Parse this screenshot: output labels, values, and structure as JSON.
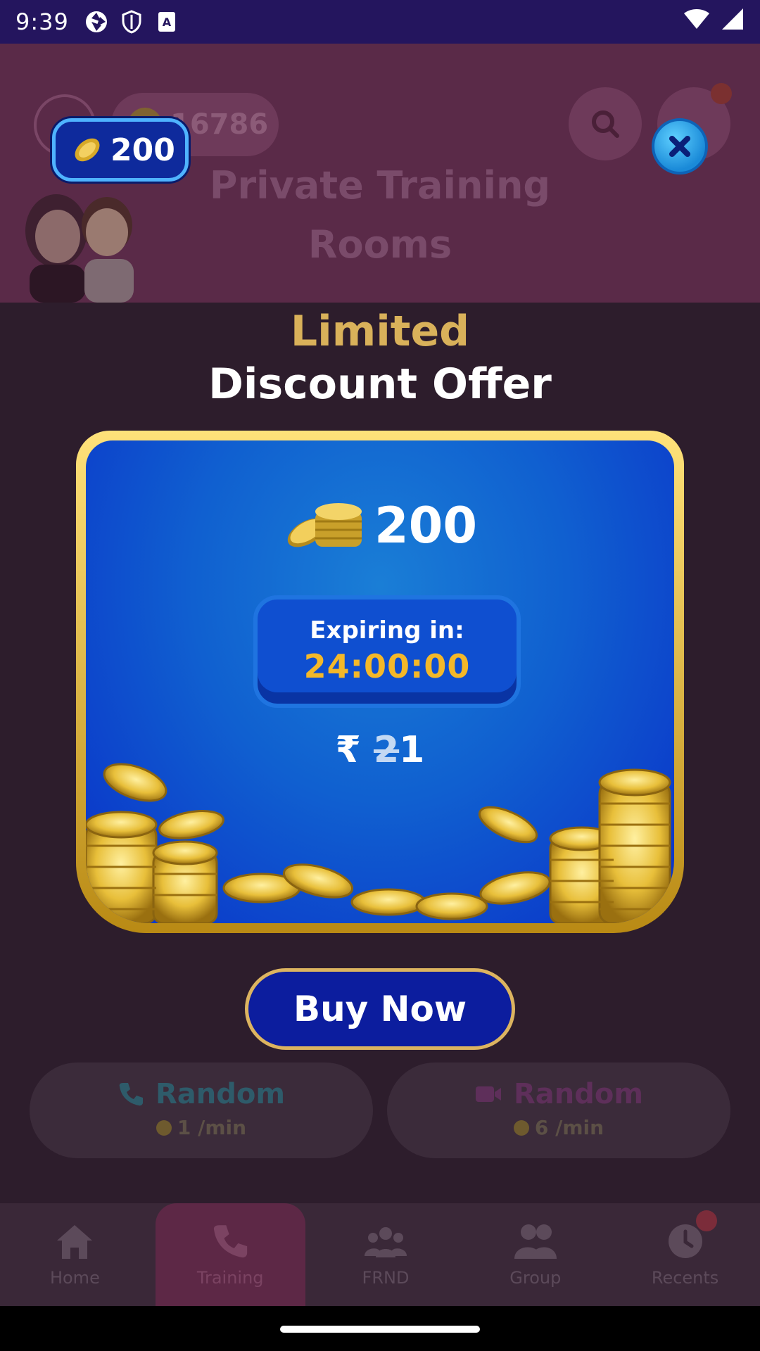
{
  "status_bar": {
    "time": "9:39",
    "icons": [
      "camera-aperture-icon",
      "shield-icon",
      "a-box-icon"
    ],
    "right_icons": [
      "wifi-icon",
      "signal-icon"
    ]
  },
  "background": {
    "coin_balance": "16786",
    "title": "Private Training Rooms",
    "call_buttons": [
      {
        "title": "Random",
        "rate": "1 /min",
        "icon": "phone-icon"
      },
      {
        "title": "Random",
        "rate": "6 /min",
        "icon": "video-camera-icon"
      }
    ],
    "nav": [
      {
        "label": "Home",
        "icon": "home-icon",
        "active": false
      },
      {
        "label": "Training",
        "icon": "phone-icon",
        "active": true
      },
      {
        "label": "FRND",
        "icon": "friends-icon",
        "active": false
      },
      {
        "label": "Group",
        "icon": "group-icon",
        "active": false
      },
      {
        "label": "Recents",
        "icon": "clock-icon",
        "active": false
      }
    ]
  },
  "modal": {
    "coin_pill_amount": "200",
    "heading_line1": "Limited",
    "heading_line2": "Discount Offer",
    "offer_coins": "200",
    "expiry_label": "Expiring in:",
    "expiry_timer": "24:00:00",
    "price_symbol": "₹",
    "price_old": "2",
    "price_new": "1",
    "buy_label": "Buy Now",
    "colors": {
      "gold": "#d9b15a",
      "card_blue": "#1060d0",
      "button_blue": "#0c1d9e",
      "timer_yellow": "#f4b829"
    }
  }
}
